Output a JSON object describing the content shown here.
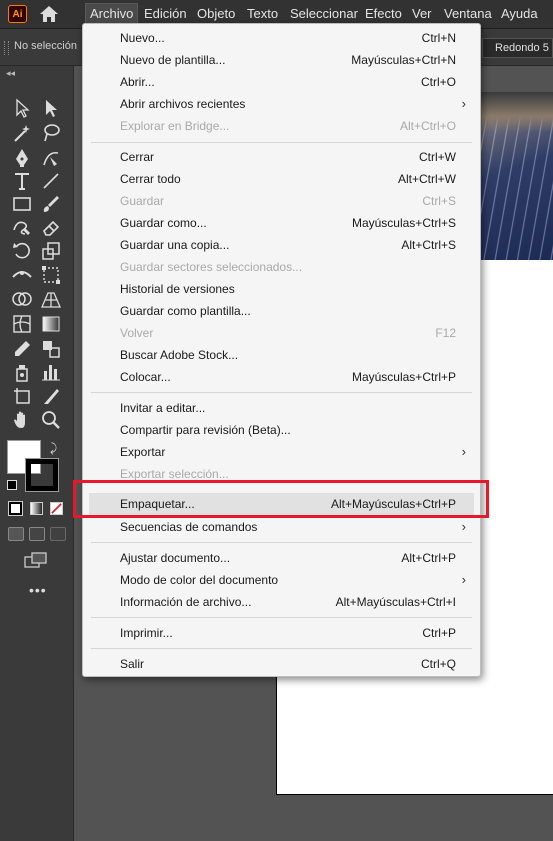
{
  "menubar": {
    "logo": "Ai",
    "items": [
      "Archivo",
      "Edición",
      "Objeto",
      "Texto",
      "Seleccionar",
      "Efecto",
      "Ver",
      "Ventana",
      "Ayuda"
    ]
  },
  "controlbar": {
    "selection_status": "No selección",
    "brush_preset": "Redondo 5 ..."
  },
  "toolbar": {
    "collapse_label": "◂◂",
    "more_tools": "•••"
  },
  "archivo_menu": {
    "items": [
      {
        "label": "Nuevo...",
        "shortcut": "Ctrl+N"
      },
      {
        "label": "Nuevo de plantilla...",
        "shortcut": "Mayúsculas+Ctrl+N"
      },
      {
        "label": "Abrir...",
        "shortcut": "Ctrl+O"
      },
      {
        "label": "Abrir archivos recientes",
        "shortcut": "",
        "submenu": true
      },
      {
        "label": "Explorar en Bridge...",
        "shortcut": "Alt+Ctrl+O",
        "disabled": true
      },
      {
        "label": "Cerrar",
        "shortcut": "Ctrl+W"
      },
      {
        "label": "Cerrar todo",
        "shortcut": "Alt+Ctrl+W"
      },
      {
        "label": "Guardar",
        "shortcut": "Ctrl+S",
        "disabled": true
      },
      {
        "label": "Guardar como...",
        "shortcut": "Mayúsculas+Ctrl+S"
      },
      {
        "label": "Guardar una copia...",
        "shortcut": "Alt+Ctrl+S"
      },
      {
        "label": "Guardar sectores seleccionados...",
        "shortcut": "",
        "disabled": true
      },
      {
        "label": "Historial de versiones",
        "shortcut": ""
      },
      {
        "label": "Guardar como plantilla...",
        "shortcut": ""
      },
      {
        "label": "Volver",
        "shortcut": "F12",
        "disabled": true
      },
      {
        "label": "Buscar Adobe Stock...",
        "shortcut": ""
      },
      {
        "label": "Colocar...",
        "shortcut": "Mayúsculas+Ctrl+P"
      },
      {
        "label": "Invitar a editar...",
        "shortcut": ""
      },
      {
        "label": "Compartir para revisión (Beta)...",
        "shortcut": ""
      },
      {
        "label": "Exportar",
        "shortcut": "",
        "submenu": true
      },
      {
        "label": "Exportar selección...",
        "shortcut": "",
        "disabled": true
      },
      {
        "label": "Empaquetar...",
        "shortcut": "Alt+Mayúsculas+Ctrl+P",
        "highlighted": true
      },
      {
        "label": "Secuencias de comandos",
        "shortcut": "",
        "submenu": true
      },
      {
        "label": "Ajustar documento...",
        "shortcut": "Alt+Ctrl+P"
      },
      {
        "label": "Modo de color del documento",
        "shortcut": "",
        "submenu": true
      },
      {
        "label": "Información de archivo...",
        "shortcut": "Alt+Mayúsculas+Ctrl+I"
      },
      {
        "label": "Imprimir...",
        "shortcut": "Ctrl+P"
      },
      {
        "label": "Salir",
        "shortcut": "Ctrl+Q"
      }
    ],
    "submenu_arrow": "›"
  },
  "colors": {
    "highlight_box": "#e5182c",
    "menu_bg": "#f5f5f5",
    "app_dark": "#323232"
  }
}
